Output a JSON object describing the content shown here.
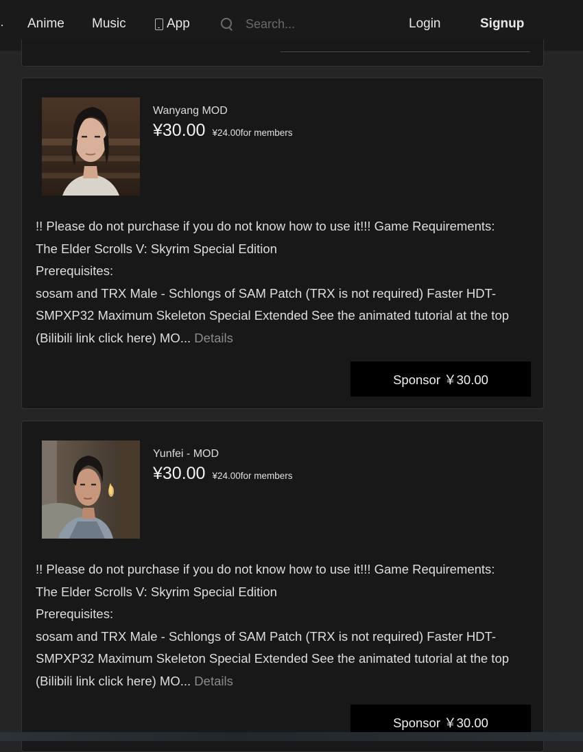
{
  "nav": {
    "edge_glyph": "·",
    "anime": "Anime",
    "music": "Music",
    "app": "App",
    "search_placeholder": "Search...",
    "login": "Login",
    "signup": "Signup"
  },
  "products": [
    {
      "name": "Wanyang MOD",
      "price": "¥30.00",
      "member_price": "¥24.00for members",
      "desc_line1": "!! Please do not purchase if you do not know how to use it!!! Game Requirements:",
      "desc_line2": "The Elder Scrolls V: Skyrim Special Edition",
      "desc_line3": "Prerequisites:",
      "desc_line4": "sosam and TRX Male - Schlongs of SAM Patch (TRX is not required) Faster HDT-SMPXP32 Maximum Skeleton Special Extended See the animated tutorial at the top (Bilibili link click here) MO...",
      "details": "Details",
      "sponsor": "Sponsor ￥30.00"
    },
    {
      "name": "Yunfei - MOD",
      "price": "¥30.00",
      "member_price": "¥24.00for members",
      "desc_line1": "!! Please do not purchase if you do not know how to use it!!! Game Requirements:",
      "desc_line2": "The Elder Scrolls V: Skyrim Special Edition",
      "desc_line3": "Prerequisites:",
      "desc_line4": "sosam and TRX Male - Schlongs of SAM Patch (TRX is not required) Faster HDT-SMPXP32 Maximum Skeleton Special Extended See the animated tutorial at the top (Bilibili link click here) MO...",
      "details": "Details",
      "sponsor": "Sponsor ￥30.00"
    }
  ]
}
